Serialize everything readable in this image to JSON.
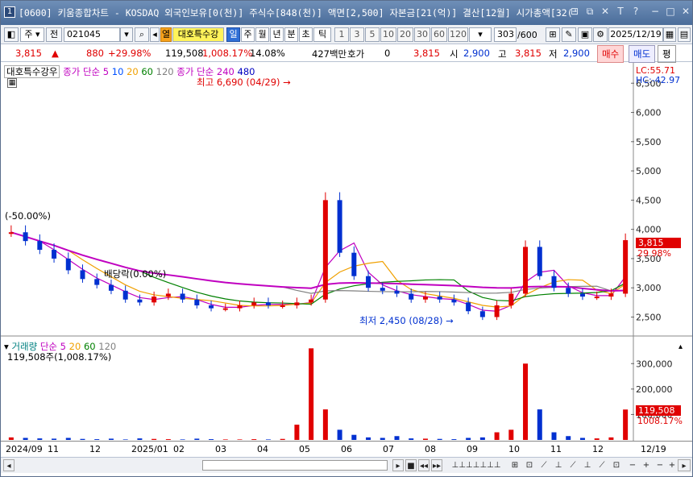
{
  "window": {
    "number": "1",
    "title": "[0600] 키움종합차트 - KOSDAQ 외국인보유[0(천)] 주식수[848(천)] 액면[2,500] 자본금[21(억)] 결산[12월] 시가총액[32('"
  },
  "toolbar": {
    "code": "021045",
    "name": "대호특수강",
    "label_ju": "주",
    "label_jeon": "전",
    "label_yeol": "열",
    "periods": [
      "일",
      "주",
      "월",
      "년",
      "분",
      "초",
      "틱"
    ],
    "intervals": [
      "1",
      "3",
      "5",
      "10",
      "20",
      "30",
      "60",
      "120"
    ],
    "count": "303",
    "total": "/600",
    "date": "2025/12/19"
  },
  "quote": {
    "price": "3,815",
    "change": "880",
    "change_pct": "+29.98%",
    "volume": "119,508",
    "volume_ratio": "1,008.17%",
    "turnover": "14.08%",
    "amount": "427백만",
    "hoga_label": "호가",
    "hoga": "0",
    "bid": "3,815",
    "open_label": "시",
    "open": "2,900",
    "high_label": "고",
    "high": "3,815",
    "low_label": "저",
    "low": "2,900",
    "buy": "매수",
    "sell": "매도",
    "pyeong": "평"
  },
  "price_panel": {
    "stock_name": "대호특수강우",
    "legend_label": "종가 단순",
    "ma": [
      "5",
      "10",
      "20",
      "60",
      "120"
    ],
    "legend_label2": "종가 단순",
    "ma2": [
      "240",
      "480"
    ],
    "lc": "LC:55.71",
    "hc": "HC:-42.97",
    "high_note": "최고 6,690 (04/29)",
    "low_note": "최저 2,450 (08/28)",
    "left_note": "(-50.00%)",
    "div_note": "배당락(0.00%)",
    "last_price": "3,815",
    "last_pct": "29.98%"
  },
  "volume_panel": {
    "label": "거래량",
    "ma_label": "단순",
    "ma": [
      "5",
      "20",
      "60",
      "120"
    ],
    "value_note": "119,508주(1,008.17%)",
    "last_volume": "119,508",
    "last_pct": "1008.17%"
  },
  "colors": {
    "up": "#e00000",
    "down": "#0030d0",
    "ma5": "#c000c0",
    "ma10": "#0050ff",
    "ma20": "#f0a000",
    "ma60": "#008000",
    "ma120": "#808080",
    "ma240": "#c000c0",
    "ma480": "#0000c0"
  },
  "chart_data": [
    {
      "type": "candlestick",
      "title": "대호특수강우 일봉",
      "y_ticks": [
        "6,500",
        "6,000",
        "5,500",
        "5,000",
        "4,500",
        "4,000",
        "3,500",
        "3,000",
        "2,500"
      ],
      "ylim": [
        2300,
        6600
      ],
      "x_ticks": [
        "2024/09",
        "11",
        "12",
        "2025/01",
        "02",
        "03",
        "04",
        "05",
        "06",
        "07",
        "08",
        "09",
        "10",
        "11",
        "12",
        "12/19"
      ],
      "series": [
        {
          "name": "종가",
          "values": [
            3950,
            3800,
            3650,
            3500,
            3300,
            3150,
            3050,
            2950,
            2800,
            2750,
            2850,
            2900,
            2800,
            2700,
            2650,
            2650,
            2700,
            2750,
            2700,
            2700,
            2750,
            2800,
            4500,
            3600,
            3200,
            3000,
            2950,
            2900,
            2800,
            2850,
            2800,
            2750,
            2600,
            2500,
            2700,
            2900,
            3700,
            3200,
            3000,
            2900,
            2850,
            2850,
            2900,
            3815
          ]
        }
      ],
      "annotations": [
        "최고 6,690 (04/29)",
        "최저 2,450 (08/28)",
        "배당락(0.00%)",
        "(-50.00%)"
      ]
    },
    {
      "type": "bar",
      "title": "거래량",
      "y_ticks": [
        "300,000",
        "200,000",
        "100,000"
      ],
      "ylim": [
        0,
        380000
      ],
      "series": [
        {
          "name": "거래량",
          "values": [
            10000,
            8000,
            6000,
            5000,
            8000,
            4000,
            3000,
            5000,
            2000,
            6000,
            4000,
            3000,
            2000,
            5000,
            3000,
            2000,
            2000,
            3000,
            2000,
            4000,
            60000,
            360000,
            120000,
            40000,
            20000,
            10000,
            8000,
            15000,
            6000,
            5000,
            4000,
            3000,
            8000,
            10000,
            30000,
            40000,
            300000,
            120000,
            30000,
            15000,
            8000,
            6000,
            10000,
            119508
          ]
        }
      ]
    }
  ]
}
